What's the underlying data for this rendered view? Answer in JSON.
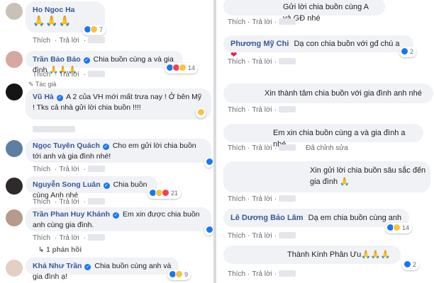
{
  "actions": {
    "like": "Thích",
    "reply": "Trả lời",
    "dot": "·"
  },
  "left": {
    "comments": [
      {
        "name": "Ho Ngoc Ha",
        "text": "🙏🙏🙏",
        "reactions": "7"
      },
      {
        "name": "Trần Bảo Bảo",
        "text": "Chia buồn cùng a và gia đình 🙏🙏🙏",
        "reactions": "14"
      },
      {
        "tag": "Tác giả",
        "name": "Vũ Hà",
        "text": "A 2 của VH mới mất trưa nay ! Ở bên Mỹ ! Tks cả nhà gửi lời chia buồn !!!!",
        "reactions": ""
      },
      {
        "name": "Ngọc Tuyên Quách",
        "text": "Cho em gửi lời chia buồn tới anh và gia đình nhé!",
        "reactions": ""
      },
      {
        "name": "Nguyễn Song Luân",
        "text": "Chia buồn cùng Anh nhé",
        "reactions": "21"
      },
      {
        "name": "Trần Phan Huy Khánh",
        "text": "Em xin được chia buồn anh cùng gia đình.",
        "reactions": ""
      },
      {
        "name": "Khả Như Trần",
        "text": "Chia buồn cùng anh và gia đình ạ!",
        "reactions": "9"
      }
    ],
    "reply_link": "1 phản hồi"
  },
  "right": {
    "comments": [
      {
        "name": "",
        "text": "Gửi lời chia buồn cùng A và GĐ nhé",
        "reactions": ""
      },
      {
        "name": "Phương Mỹ Chi",
        "text": "Dạ con chia buồn với gđ chú a",
        "reactions": "2"
      },
      {
        "name": "",
        "text": "Xin thành tâm chia buồn với gia đình anh nhé",
        "reactions": ""
      },
      {
        "name": "",
        "text": "Em xin chia buồn cùng a và gia đình a nhé",
        "reactions": "",
        "edited": "Đã chỉnh sửa"
      },
      {
        "name": "",
        "text": "Xin gửi lời chia buồn sâu sắc đến gia đình 🙏",
        "reactions": ""
      },
      {
        "name": "Lê Dương Bảo Lâm",
        "text": "Dạ em chia buồn cùng anh",
        "reactions": "14"
      },
      {
        "name": "",
        "text": "Thành Kính Phân Ưu🙏🙏🙏",
        "reactions": "2"
      }
    ]
  },
  "colors": {
    "name": "#385898",
    "bubble": "#f0f2f5",
    "meta": "#65676b",
    "like": "#1877f2",
    "heart": "#e41e3f"
  },
  "icons": [
    "verified-badge-icon",
    "like-reaction-icon",
    "sad-reaction-icon",
    "love-reaction-icon",
    "heart-icon",
    "pray-emoji-icon"
  ]
}
